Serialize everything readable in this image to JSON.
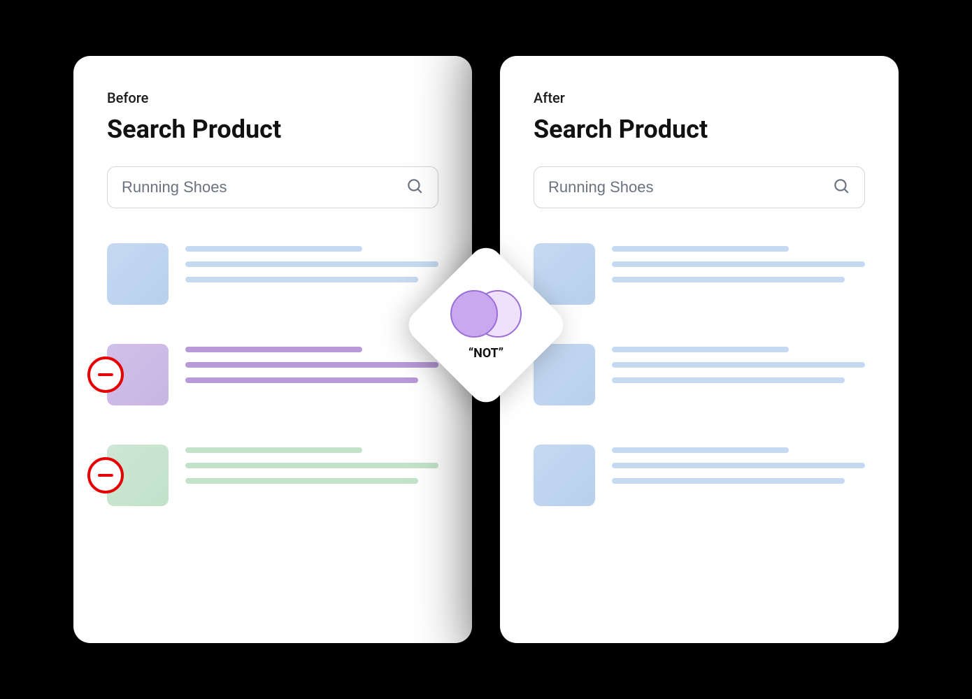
{
  "before": {
    "label": "Before",
    "title": "Search Product",
    "search_value": "Running Shoes",
    "results": [
      {
        "color": "blue"
      },
      {
        "color": "purple",
        "removable": true
      },
      {
        "color": "green",
        "removable": true
      }
    ]
  },
  "after": {
    "label": "After",
    "title": "Search Product",
    "search_value": "Running Shoes",
    "results": [
      {
        "color": "blue"
      },
      {
        "color": "blue"
      },
      {
        "color": "blue"
      }
    ]
  },
  "center": {
    "operator_label": "“NOT”"
  },
  "colors": {
    "blue": "#c5d9f1",
    "purple": "#c9b5e4",
    "green": "#c2e2ca",
    "remove_red": "#e60000",
    "venn_fill_left": "#c9a8ef",
    "venn_fill_right": "#f0e1fa",
    "venn_stroke": "#9b6dd7"
  }
}
